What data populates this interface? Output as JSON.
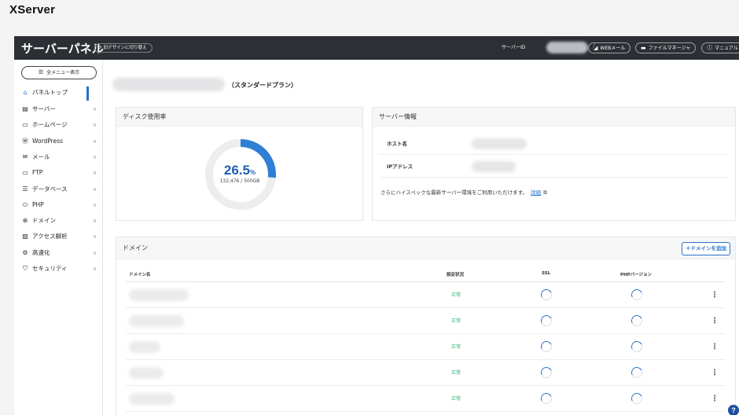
{
  "app": {
    "logo": "XServer"
  },
  "header": {
    "title": "サーバーパネル",
    "old_design_label": "旧デザインに切り替え",
    "server_id_label": "サーバーID",
    "separator": "/",
    "buttons": [
      {
        "label": "WEBメール",
        "icon": "paper-plane-icon"
      },
      {
        "label": "ファイルマネージャ",
        "icon": "folder-icon"
      },
      {
        "label": "マニュアル",
        "icon": "help-circle-icon"
      }
    ]
  },
  "sidebar": {
    "menu_all_label": "全メニュー表示",
    "items": [
      {
        "label": "パネルトップ",
        "icon": "home-icon",
        "active": true
      },
      {
        "label": "サーバー",
        "icon": "server-icon"
      },
      {
        "label": "ホームページ",
        "icon": "window-icon"
      },
      {
        "label": "WordPress",
        "icon": "wordpress-icon"
      },
      {
        "label": "メール",
        "icon": "mail-icon"
      },
      {
        "label": "FTP",
        "icon": "monitor-icon"
      },
      {
        "label": "データベース",
        "icon": "database-icon"
      },
      {
        "label": "PHP",
        "icon": "php-icon"
      },
      {
        "label": "ドメイン",
        "icon": "globe-icon"
      },
      {
        "label": "アクセス解析",
        "icon": "chart-icon"
      },
      {
        "label": "高速化",
        "icon": "speed-icon"
      },
      {
        "label": "セキュリティ",
        "icon": "shield-icon"
      }
    ]
  },
  "plan": {
    "label": "（スタンダードプラン）"
  },
  "disk": {
    "title": "ディスク使用率",
    "percent": 26.5,
    "percent_text": "26.5",
    "percent_unit": "%",
    "usage_text": "132,476 / 500GB",
    "colors": {
      "used": "#2f7fd6",
      "track": "#ededed"
    }
  },
  "server_info": {
    "title": "サーバー情報",
    "rows": [
      {
        "key": "ホスト名"
      },
      {
        "key": "IPアドレス"
      }
    ],
    "upgrade_text": "さらにハイスペックな最新サーバー環境をご利用いただけます。",
    "detail_link": "詳細"
  },
  "domains": {
    "title": "ドメイン",
    "add_button": "＋ドメインを追加",
    "columns": [
      "ドメイン名",
      "設定状況",
      "SSL",
      "PHPバージョン"
    ],
    "rows": [
      {
        "status": "正常"
      },
      {
        "status": "正常"
      },
      {
        "status": "正常"
      },
      {
        "status": "正常"
      },
      {
        "status": "正常"
      }
    ]
  },
  "help": {
    "label": "?"
  }
}
